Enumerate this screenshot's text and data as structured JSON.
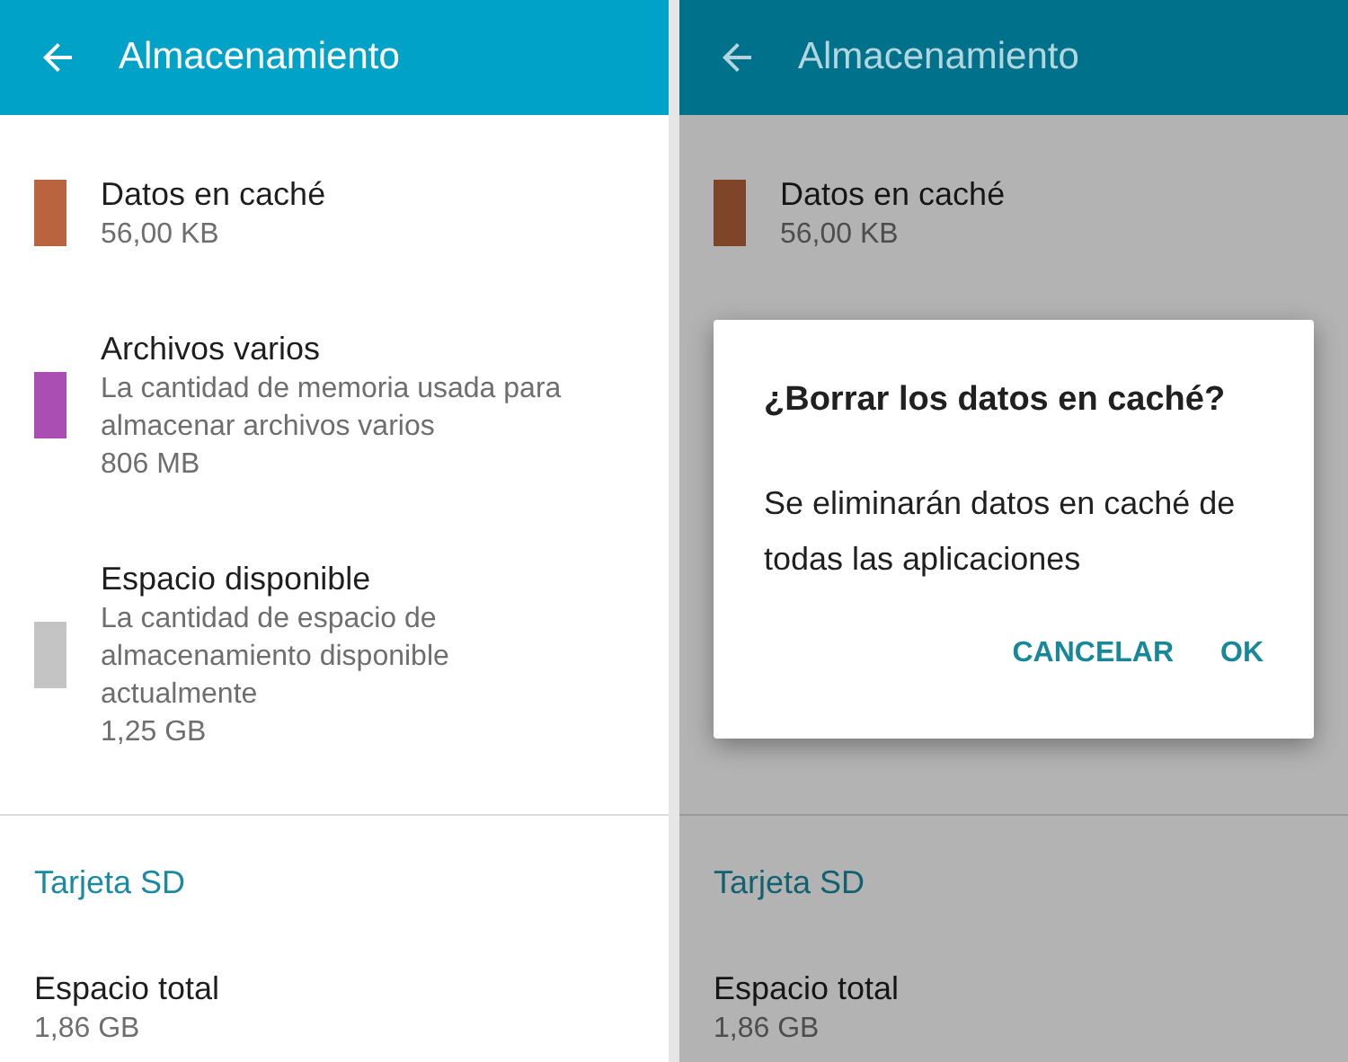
{
  "screens": [
    {
      "title": "Almacenamiento",
      "dimmed": false,
      "items": [
        {
          "title": "Datos en caché",
          "lines": [
            "56,00 KB"
          ],
          "color": "#b9643e"
        },
        {
          "title": "Archivos varios",
          "lines": [
            "La cantidad de memoria usada para almacenar archivos varios",
            "806 MB"
          ],
          "color": "#a94fb3"
        },
        {
          "title": "Espacio disponible",
          "lines": [
            "La cantidad de espacio de almacenamiento disponible actualmente",
            "1,25 GB"
          ],
          "color": "#c4c4c4"
        }
      ],
      "section": "Tarjeta SD",
      "total": {
        "title": "Espacio total",
        "value": "1,86 GB"
      }
    },
    {
      "title": "Almacenamiento",
      "dimmed": true,
      "items": [
        {
          "title": "Datos en caché",
          "lines": [
            "56,00 KB"
          ],
          "color": "#7f4529"
        }
      ],
      "section": "Tarjeta SD",
      "total": {
        "title": "Espacio total",
        "value": "1,86 GB"
      },
      "dialog": {
        "title": "¿Borrar los datos en caché?",
        "message": "Se eliminarán datos en caché de todas las aplicaciones",
        "buttons": [
          "CANCELAR",
          "OK"
        ]
      }
    }
  ]
}
